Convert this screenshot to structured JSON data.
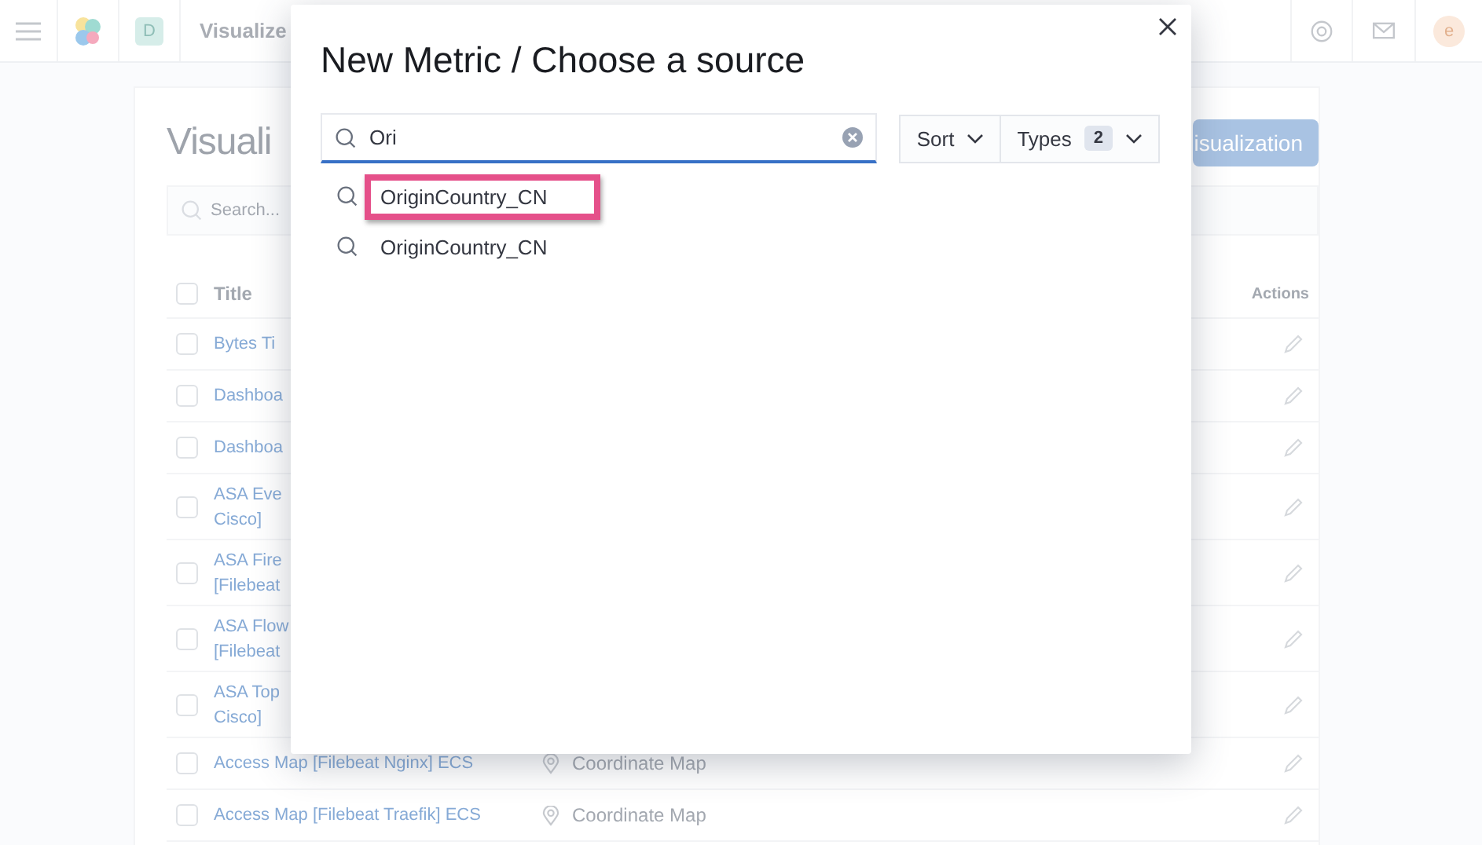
{
  "header": {
    "space_badge": "D",
    "breadcrumb": "Visualize",
    "avatar": "e"
  },
  "page": {
    "title": "Visuali",
    "create_button": "isualization",
    "search": {
      "placeholder": "Search..."
    },
    "table": {
      "columns": [
        "Title",
        "Actions"
      ],
      "all_checked": false,
      "rows": [
        {
          "title": [
            "Bytes Ti"
          ],
          "checked": false
        },
        {
          "title": [
            "Dashboa"
          ],
          "checked": false
        },
        {
          "title": [
            "Dashboa"
          ],
          "checked": false
        },
        {
          "title": [
            "ASA Eve",
            "Cisco]"
          ],
          "checked": false
        },
        {
          "title": [
            "ASA Fire",
            "[Filebeat"
          ],
          "checked": false
        },
        {
          "title": [
            "ASA Flow",
            "[Filebeat"
          ],
          "checked": false
        },
        {
          "title": [
            "ASA Top",
            "Cisco]"
          ],
          "checked": false
        },
        {
          "title": [
            "Access Map [Filebeat Nginx] ECS"
          ],
          "type": "Coordinate Map",
          "checked": false
        },
        {
          "title": [
            "Access Map [Filebeat Traefik] ECS"
          ],
          "type": "Coordinate Map",
          "checked": false
        }
      ]
    }
  },
  "modal": {
    "title": "New Metric / Choose a source",
    "search": {
      "value": "Ori"
    },
    "sort": "Sort",
    "types": {
      "label": "Types",
      "count": "2"
    },
    "results": [
      {
        "label": "OriginCountry_CN",
        "highlighted": true
      },
      {
        "label": "OriginCountry_CN",
        "highlighted": false
      }
    ]
  }
}
